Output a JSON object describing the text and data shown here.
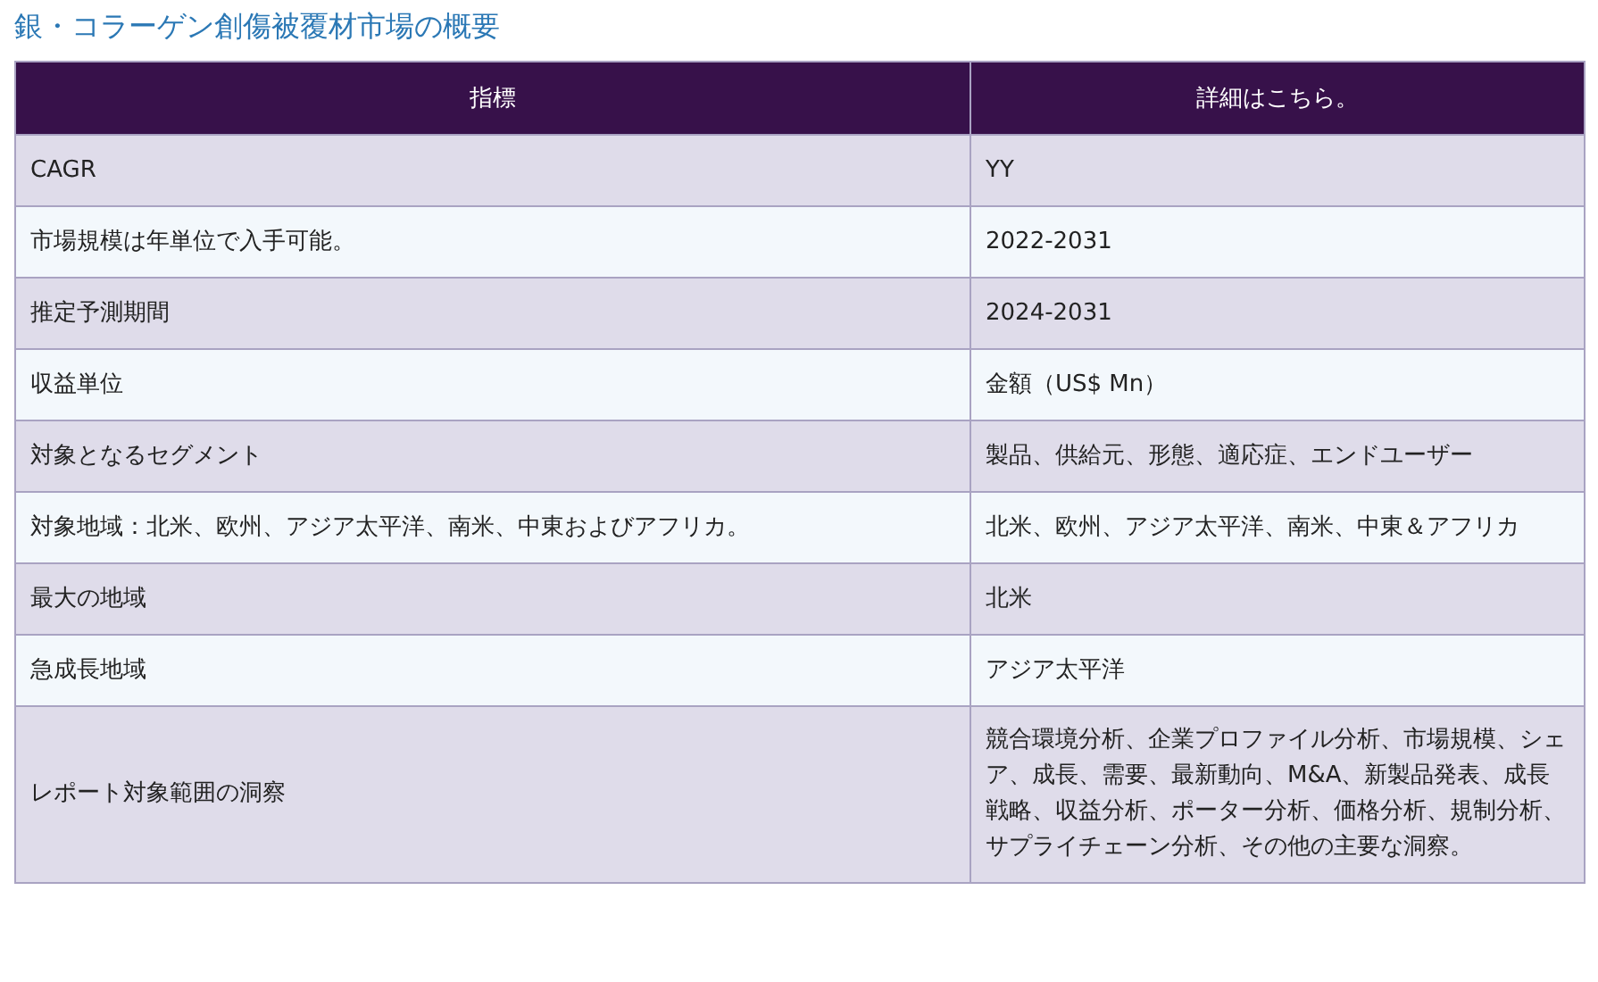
{
  "title": "銀・コラーゲン創傷被覆材市場の概要",
  "table": {
    "columns": [
      "指標",
      "詳細はこちら。"
    ],
    "rows": [
      [
        "CAGR",
        "YY"
      ],
      [
        "市場規模は年単位で入手可能。",
        "2022-2031"
      ],
      [
        "推定予測期間",
        "2024-2031"
      ],
      [
        "収益単位",
        "金額（US$ Mn）"
      ],
      [
        "対象となるセグメント",
        "製品、供給元、形態、適応症、エンドユーザー"
      ],
      [
        "対象地域：北米、欧州、アジア太平洋、南米、中東およびアフリカ。",
        "北米、欧州、アジア太平洋、南米、中東＆アフリカ"
      ],
      [
        "最大の地域",
        "北米"
      ],
      [
        "急成長地域",
        "アジア太平洋"
      ],
      [
        "レポート対象範囲の洞察",
        "競合環境分析、企業プロファイル分析、市場規模、シェア、成長、需要、最新動向、M&A、新製品発表、成長戦略、収益分析、ポーター分析、価格分析、規制分析、サプライチェーン分析、その他の主要な洞察。"
      ]
    ]
  }
}
